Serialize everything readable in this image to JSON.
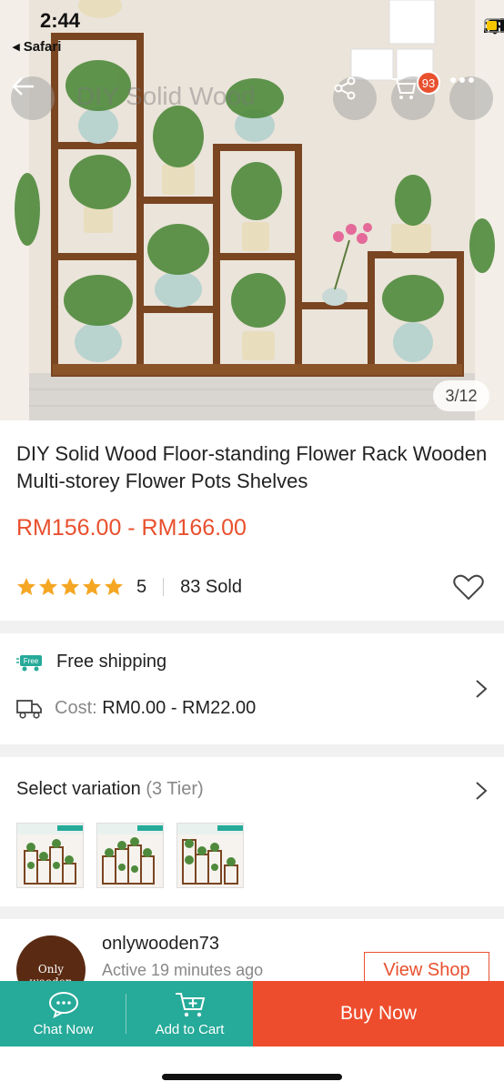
{
  "status_bar": {
    "time": "2:44",
    "back_app": "◂ Safari"
  },
  "hero": {
    "ghost_title": "DIY Solid Wood",
    "image_counter": "3/12",
    "cart_badge": "93"
  },
  "product": {
    "title": "DIY Solid Wood Floor-standing Flower Rack Wooden Multi-storey Flower Pots Shelves",
    "price": "RM156.00 - RM166.00",
    "rating": "5",
    "stars": 5,
    "sold": "83 Sold"
  },
  "shipping": {
    "free_label": "Free shipping",
    "free_icon_text": "Free",
    "cost_label": "Cost:",
    "cost_value": "RM0.00 - RM22.00"
  },
  "variation": {
    "title": "Select variation",
    "tier": "(3 Tier)"
  },
  "shop": {
    "avatar_text": "Only wooden",
    "name": "onlywooden73",
    "active": "Active 19 minutes ago",
    "view_shop": "View Shop"
  },
  "bottom_bar": {
    "chat": "Chat Now",
    "add_cart": "Add to Cart",
    "buy_now": "Buy Now"
  },
  "colors": {
    "accent": "#ee4d2d",
    "price": "#e8502e",
    "teal": "#26aa99",
    "star": "#f5a623"
  }
}
